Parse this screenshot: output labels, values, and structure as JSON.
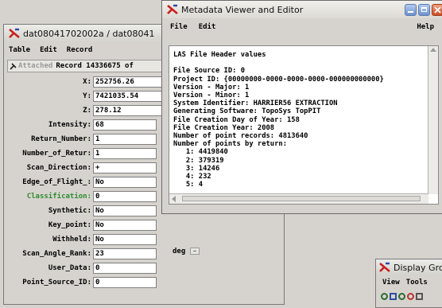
{
  "attr_window": {
    "title": "dat08041702002a / dat08041",
    "menu": [
      "Table",
      "Edit",
      "Record"
    ],
    "attached_label": "Attached",
    "record_label": "Record 14336675 of",
    "fields": [
      {
        "label": "X:",
        "value": "252756.26"
      },
      {
        "label": "Y:",
        "value": "7421035.54"
      },
      {
        "label": "Z:",
        "value": "278.12"
      },
      {
        "label": "Intensity:",
        "value": "68"
      },
      {
        "label": "Return_Number:",
        "value": "1"
      },
      {
        "label": "Number_of_Retur:",
        "value": "1"
      },
      {
        "label": "Scan_Direction:",
        "value": "+"
      },
      {
        "label": "Edge_of_Flight_:",
        "value": "No"
      },
      {
        "label": "Classification:",
        "value": "0"
      },
      {
        "label": "Synthetic:",
        "value": "No"
      },
      {
        "label": "Key_point:",
        "value": "No"
      },
      {
        "label": "Withheld:",
        "value": "No"
      },
      {
        "label": "Scan_Angle_Rank:",
        "value": "23"
      },
      {
        "label": "User_Data:",
        "value": "0"
      },
      {
        "label": "Point_Source_ID:",
        "value": "0"
      }
    ],
    "unit_select": "deg"
  },
  "metadata_window": {
    "title": "Metadata Viewer and Editor",
    "menu_file": "File",
    "menu_edit": "Edit",
    "menu_help": "Help",
    "lines": [
      "LAS File Header values",
      "",
      "File Source ID: 0",
      "Project ID: {00000000-0000-0000-0000-000000000000}",
      "Version - Major: 1",
      "Version - Minor: 1",
      "System Identifier: HARRIER56 EXTRACTION",
      "Generating Software: TopoSys TopPIT",
      "File Creation Day of Year: 158",
      "File Creation Year: 2008",
      "Number of point records: 4813640",
      "Number of points by return:",
      "   1: 4419840",
      "   2: 379319",
      "   3: 14246",
      "   4: 232",
      "   5: 4"
    ]
  },
  "display_window": {
    "title": "Display Gro",
    "menu": [
      "View",
      "Tools"
    ]
  },
  "colors": {
    "classification_label": "#2e8b2e",
    "window_bg": "#d6d3ce"
  }
}
